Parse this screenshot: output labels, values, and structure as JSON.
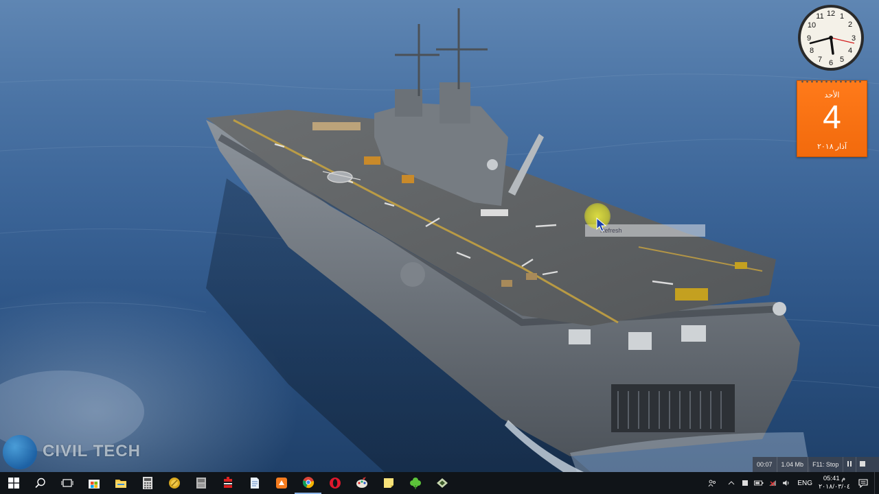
{
  "desktop": {
    "wallpaper_description_free": true
  },
  "calendar_gadget": {
    "day_name": "الأحد",
    "day_number": "4",
    "month_year": "آذار ٢٠١٨"
  },
  "clock_gadget": {
    "hour": 5,
    "minute": 41
  },
  "cursor_tooltip": {
    "text": "Refresh"
  },
  "watermark": {
    "text": "CIVIL TECH"
  },
  "recorder": {
    "elapsed": "00:07",
    "size": "1.04 Mb",
    "hint": "F11: Stop",
    "pause_icon": "pause-icon",
    "stop_icon": "stop-icon"
  },
  "taskbar": {
    "apps": [
      {
        "name": "start",
        "icon": "windows-logo-icon"
      },
      {
        "name": "search",
        "icon": "search-icon"
      },
      {
        "name": "task-view",
        "icon": "task-view-icon"
      },
      {
        "name": "store",
        "icon": "store-icon"
      },
      {
        "name": "file-explorer",
        "icon": "folder-icon"
      },
      {
        "name": "calculator",
        "icon": "calculator-icon"
      },
      {
        "name": "app-gold",
        "icon": "gold-coin-icon"
      },
      {
        "name": "app-gray",
        "icon": "gray-app-icon"
      },
      {
        "name": "app-red",
        "icon": "red-app-icon"
      },
      {
        "name": "notepad",
        "icon": "document-icon"
      },
      {
        "name": "app-orange",
        "icon": "orange-app-icon"
      },
      {
        "name": "chrome",
        "icon": "chrome-icon"
      },
      {
        "name": "opera",
        "icon": "opera-icon"
      },
      {
        "name": "paint",
        "icon": "paint-icon"
      },
      {
        "name": "sticky-notes",
        "icon": "sticky-note-icon"
      },
      {
        "name": "solitaire",
        "icon": "clover-icon"
      },
      {
        "name": "app-green",
        "icon": "green-app-icon"
      }
    ],
    "tray": {
      "language": "ENG",
      "time": "05:41 م",
      "date": "٢٠١٨/٠٣/٠٤"
    }
  },
  "colors": {
    "taskbar": "#101418",
    "calendar": "#f26a0c",
    "halo": "#e6e63c"
  }
}
